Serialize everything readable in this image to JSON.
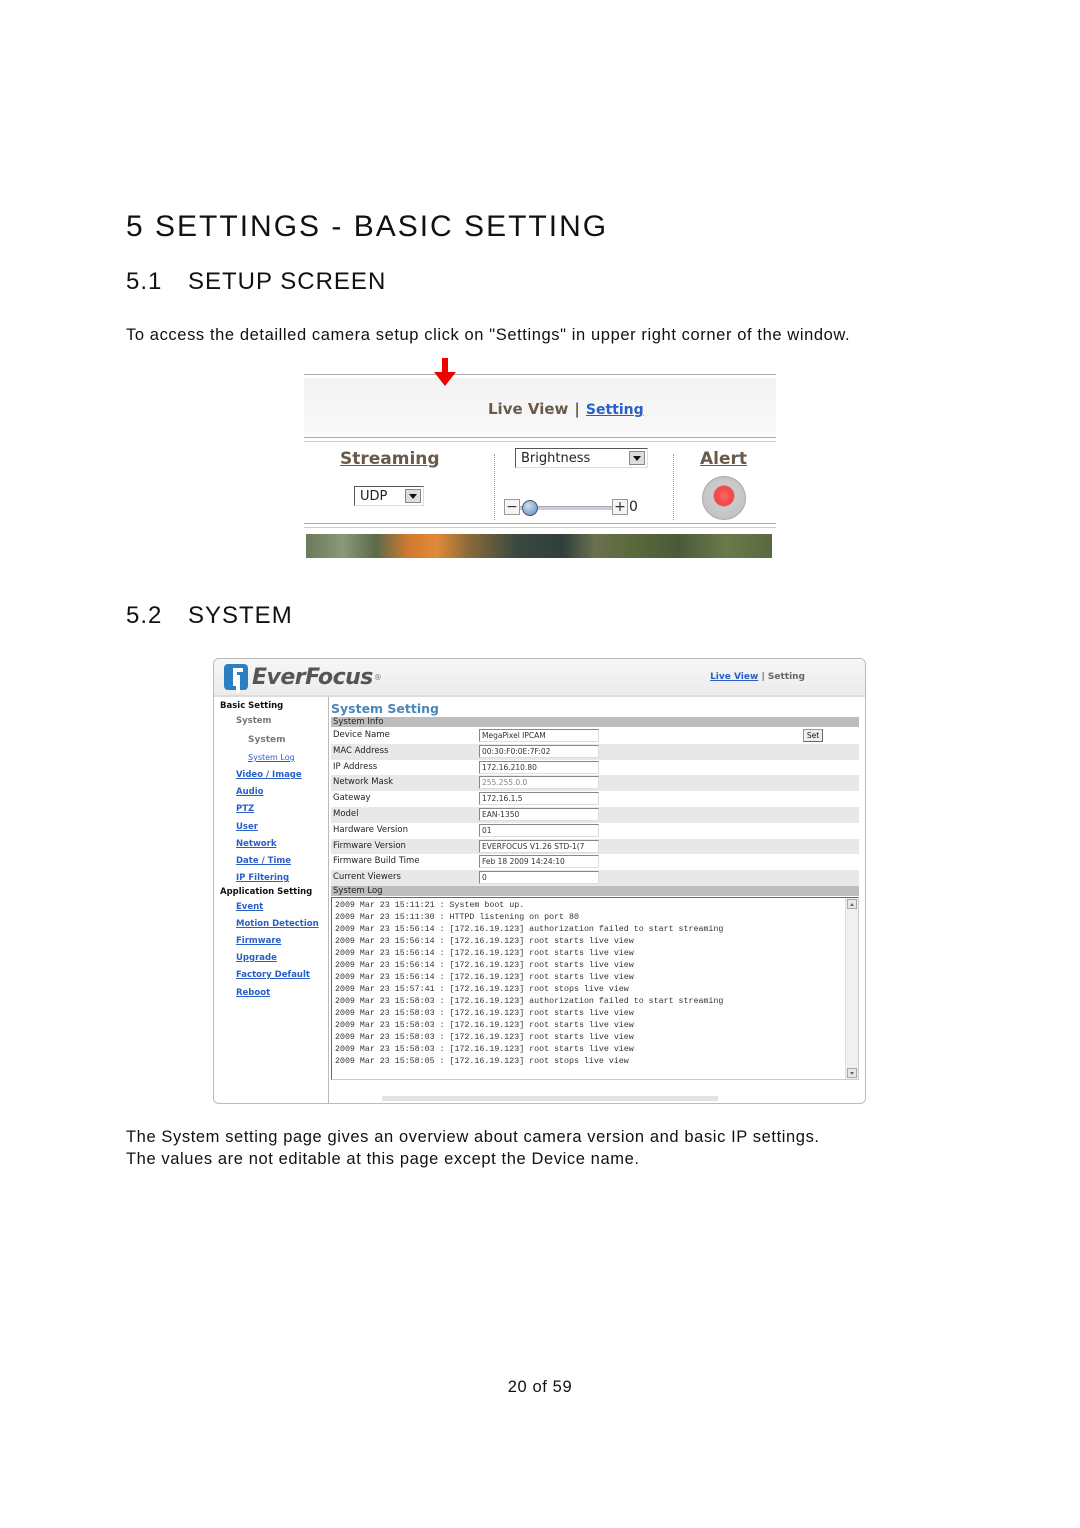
{
  "heading1": "5 SETTINGS - BASIC SETTING",
  "section_setup": {
    "number": "5.1",
    "title": "SETUP SCREEN"
  },
  "intro_text": "To access the detailled camera setup click on \"Settings\" in upper right corner of the window.",
  "figure1": {
    "nav": {
      "live_view": "Live View",
      "separator": "|",
      "setting": "Setting"
    },
    "streaming": {
      "heading": "Streaming",
      "protocol_select": "UDP"
    },
    "image_adjust": {
      "select": "Brightness",
      "minus": "−",
      "plus": "+",
      "value": "0",
      "slider_fraction": 0.05
    },
    "alert": {
      "heading": "Alert"
    },
    "icons": {
      "arrow": "red-down-arrow-icon",
      "alert": "alert-record-button-icon",
      "knob": "slider-knob-icon"
    }
  },
  "section_system": {
    "number": "5.2",
    "title": "SYSTEM"
  },
  "figure2": {
    "logo": {
      "text": "EverFocus",
      "reg": "®"
    },
    "top_nav": {
      "live_view": "Live View",
      "separator": "|",
      "setting": "Setting"
    },
    "sidebar": {
      "basic_heading": "Basic Setting",
      "system_group": "System",
      "system_current": "System",
      "system_log": "System Log",
      "items": [
        "Video / Image",
        "Audio",
        "PTZ",
        "User",
        "Network",
        "Date / Time",
        "IP Filtering"
      ],
      "application_heading": "Application Setting",
      "app_items": [
        "Event",
        "Motion Detection",
        "Firmware",
        "Upgrade",
        "Factory Default",
        "Reboot"
      ]
    },
    "main": {
      "title": "System Setting",
      "system_info_label": "System Info",
      "set_button": "Set",
      "rows": [
        {
          "label": "Device Name",
          "value": "MegaPixel IPCAM"
        },
        {
          "label": "MAC Address",
          "value": "00:30:F0:0E:7F:02"
        },
        {
          "label": "IP Address",
          "value": "172.16.210.80"
        },
        {
          "label": "Network Mask",
          "value": "255.255.0.0"
        },
        {
          "label": "Gateway",
          "value": "172.16.1.5"
        },
        {
          "label": "Model",
          "value": "EAN-1350"
        },
        {
          "label": "Hardware Version",
          "value": "01"
        },
        {
          "label": "Firmware Version",
          "value": "EVERFOCUS V1.26 STD-1(7"
        },
        {
          "label": "Firmware Build Time",
          "value": "Feb 18 2009 14:24:10"
        },
        {
          "label": "Current Viewers",
          "value": "0"
        }
      ],
      "system_log_label": "System Log",
      "log": [
        "2009 Mar 23 15:11:21 : System boot up.",
        "2009 Mar 23 15:11:30 : HTTPD listening on port 80",
        "2009 Mar 23 15:56:14 : [172.16.19.123] authorization failed to start streaming",
        "2009 Mar 23 15:56:14 : [172.16.19.123] root starts live view",
        "2009 Mar 23 15:56:14 : [172.16.19.123] root starts live view",
        "2009 Mar 23 15:56:14 : [172.16.19.123] root starts live view",
        "2009 Mar 23 15:56:14 : [172.16.19.123] root starts live view",
        "2009 Mar 23 15:57:41 : [172.16.19.123] root stops live view",
        "2009 Mar 23 15:58:03 : [172.16.19.123] authorization failed to start streaming",
        "2009 Mar 23 15:58:03 : [172.16.19.123] root starts live view",
        "2009 Mar 23 15:58:03 : [172.16.19.123] root starts live view",
        "2009 Mar 23 15:58:03 : [172.16.19.123] root starts live view",
        "2009 Mar 23 15:58:03 : [172.16.19.123] root starts live view",
        "2009 Mar 23 15:58:05 : [172.16.19.123] root stops live view"
      ]
    }
  },
  "description": [
    "The System setting page gives an overview about camera version and basic IP settings.",
    "The values are not editable at this page except the Device name."
  ],
  "footer": "20 of 59",
  "colors": {
    "link": "#2a5fc8",
    "title_blue": "#4a86b8",
    "arrow": "#ee0000",
    "header_brown": "#6a5a4a"
  }
}
